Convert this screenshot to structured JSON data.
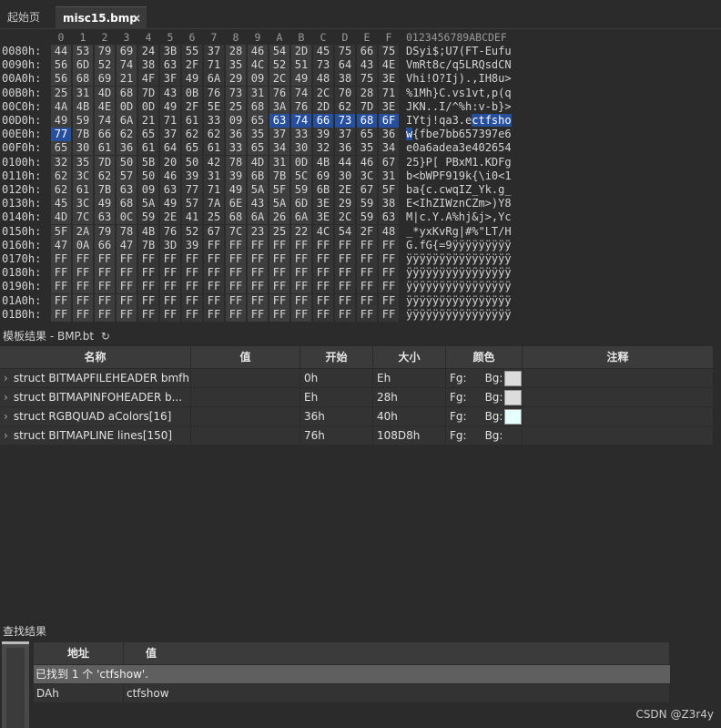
{
  "tabs": [
    {
      "label": "起始页",
      "active": false
    },
    {
      "label": "misc15.bmp",
      "active": true,
      "close": "×"
    }
  ],
  "hex": {
    "column_headers": [
      "0",
      "1",
      "2",
      "3",
      "4",
      "5",
      "6",
      "7",
      "8",
      "9",
      "A",
      "B",
      "C",
      "D",
      "E",
      "F"
    ],
    "ascii_header": "0123456789ABCDEF",
    "rows": [
      {
        "addr": "0080h:",
        "bytes": [
          "44",
          "53",
          "79",
          "69",
          "24",
          "3B",
          "55",
          "37",
          "28",
          "46",
          "54",
          "2D",
          "45",
          "75",
          "66",
          "75"
        ],
        "ascii": "DSyi$;U7(FT-Eufu"
      },
      {
        "addr": "0090h:",
        "bytes": [
          "56",
          "6D",
          "52",
          "74",
          "38",
          "63",
          "2F",
          "71",
          "35",
          "4C",
          "52",
          "51",
          "73",
          "64",
          "43",
          "4E"
        ],
        "ascii": "VmRt8c/q5LRQsdCN"
      },
      {
        "addr": "00A0h:",
        "bytes": [
          "56",
          "68",
          "69",
          "21",
          "4F",
          "3F",
          "49",
          "6A",
          "29",
          "09",
          "2C",
          "49",
          "48",
          "38",
          "75",
          "3E"
        ],
        "ascii": "Vhi!O?Ij).,IH8u>"
      },
      {
        "addr": "00B0h:",
        "bytes": [
          "25",
          "31",
          "4D",
          "68",
          "7D",
          "43",
          "0B",
          "76",
          "73",
          "31",
          "76",
          "74",
          "2C",
          "70",
          "28",
          "71"
        ],
        "ascii": "%1Mh}C.vs1vt,p(q"
      },
      {
        "addr": "00C0h:",
        "bytes": [
          "4A",
          "4B",
          "4E",
          "0D",
          "0D",
          "49",
          "2F",
          "5E",
          "25",
          "68",
          "3A",
          "76",
          "2D",
          "62",
          "7D",
          "3E"
        ],
        "ascii": "JKN..I/^%h:v-b}>"
      },
      {
        "addr": "00D0h:",
        "bytes": [
          "49",
          "59",
          "74",
          "6A",
          "21",
          "71",
          "61",
          "33",
          "09",
          "65",
          "63",
          "74",
          "66",
          "73",
          "68",
          "6F"
        ],
        "ascii": "IYtj!qa3.ectfsho",
        "sel_from": 10,
        "sel_to": 15,
        "ascii_sel_from": 10,
        "ascii_sel_to": 16
      },
      {
        "addr": "00E0h:",
        "bytes": [
          "77",
          "7B",
          "66",
          "62",
          "65",
          "37",
          "62",
          "62",
          "36",
          "35",
          "37",
          "33",
          "39",
          "37",
          "65",
          "36"
        ],
        "ascii": "w{fbe7bb657397e6",
        "sel_from": 0,
        "sel_to": 0,
        "ascii_sel_from": 0,
        "ascii_sel_to": 1
      },
      {
        "addr": "00F0h:",
        "bytes": [
          "65",
          "30",
          "61",
          "36",
          "61",
          "64",
          "65",
          "61",
          "33",
          "65",
          "34",
          "30",
          "32",
          "36",
          "35",
          "34"
        ],
        "ascii": "e0a6adea3e402654"
      },
      {
        "addr": "0100h:",
        "bytes": [
          "32",
          "35",
          "7D",
          "50",
          "5B",
          "20",
          "50",
          "42",
          "78",
          "4D",
          "31",
          "0D",
          "4B",
          "44",
          "46",
          "67"
        ],
        "ascii": "25}P[ PBxM1.KDFg"
      },
      {
        "addr": "0110h:",
        "bytes": [
          "62",
          "3C",
          "62",
          "57",
          "50",
          "46",
          "39",
          "31",
          "39",
          "6B",
          "7B",
          "5C",
          "69",
          "30",
          "3C",
          "31"
        ],
        "ascii": "b<bWPF919k{\\i0<1"
      },
      {
        "addr": "0120h:",
        "bytes": [
          "62",
          "61",
          "7B",
          "63",
          "09",
          "63",
          "77",
          "71",
          "49",
          "5A",
          "5F",
          "59",
          "6B",
          "2E",
          "67",
          "5F"
        ],
        "ascii": "ba{c.cwqIZ_Yk.g_"
      },
      {
        "addr": "0130h:",
        "bytes": [
          "45",
          "3C",
          "49",
          "68",
          "5A",
          "49",
          "57",
          "7A",
          "6E",
          "43",
          "5A",
          "6D",
          "3E",
          "29",
          "59",
          "38"
        ],
        "ascii": "E<IhZIWznCZm>)Y8"
      },
      {
        "addr": "0140h:",
        "bytes": [
          "4D",
          "7C",
          "63",
          "0C",
          "59",
          "2E",
          "41",
          "25",
          "68",
          "6A",
          "26",
          "6A",
          "3E",
          "2C",
          "59",
          "63"
        ],
        "ascii": "M|c.Y.A%hj&j>,Yc"
      },
      {
        "addr": "0150h:",
        "bytes": [
          "5F",
          "2A",
          "79",
          "78",
          "4B",
          "76",
          "52",
          "67",
          "7C",
          "23",
          "25",
          "22",
          "4C",
          "54",
          "2F",
          "48"
        ],
        "ascii": "_*yxKvRg|#%\"LT/H"
      },
      {
        "addr": "0160h:",
        "bytes": [
          "47",
          "0A",
          "66",
          "47",
          "7B",
          "3D",
          "39",
          "FF",
          "FF",
          "FF",
          "FF",
          "FF",
          "FF",
          "FF",
          "FF",
          "FF"
        ],
        "ascii": "G.fG{=9ÿÿÿÿÿÿÿÿÿ"
      },
      {
        "addr": "0170h:",
        "bytes": [
          "FF",
          "FF",
          "FF",
          "FF",
          "FF",
          "FF",
          "FF",
          "FF",
          "FF",
          "FF",
          "FF",
          "FF",
          "FF",
          "FF",
          "FF",
          "FF"
        ],
        "ascii": "ÿÿÿÿÿÿÿÿÿÿÿÿÿÿÿÿ"
      },
      {
        "addr": "0180h:",
        "bytes": [
          "FF",
          "FF",
          "FF",
          "FF",
          "FF",
          "FF",
          "FF",
          "FF",
          "FF",
          "FF",
          "FF",
          "FF",
          "FF",
          "FF",
          "FF",
          "FF"
        ],
        "ascii": "ÿÿÿÿÿÿÿÿÿÿÿÿÿÿÿÿ"
      },
      {
        "addr": "0190h:",
        "bytes": [
          "FF",
          "FF",
          "FF",
          "FF",
          "FF",
          "FF",
          "FF",
          "FF",
          "FF",
          "FF",
          "FF",
          "FF",
          "FF",
          "FF",
          "FF",
          "FF"
        ],
        "ascii": "ÿÿÿÿÿÿÿÿÿÿÿÿÿÿÿÿ"
      },
      {
        "addr": "01A0h:",
        "bytes": [
          "FF",
          "FF",
          "FF",
          "FF",
          "FF",
          "FF",
          "FF",
          "FF",
          "FF",
          "FF",
          "FF",
          "FF",
          "FF",
          "FF",
          "FF",
          "FF"
        ],
        "ascii": "ÿÿÿÿÿÿÿÿÿÿÿÿÿÿÿÿ"
      },
      {
        "addr": "01B0h:",
        "bytes": [
          "FF",
          "FF",
          "FF",
          "FF",
          "FF",
          "FF",
          "FF",
          "FF",
          "FF",
          "FF",
          "FF",
          "FF",
          "FF",
          "FF",
          "FF",
          "FF"
        ],
        "ascii": "ÿÿÿÿÿÿÿÿÿÿÿÿÿÿÿÿ"
      }
    ]
  },
  "template": {
    "title": "模板结果 - BMP.bt",
    "refresh_icon": "↻",
    "columns": [
      "名称",
      "值",
      "开始",
      "大小",
      "颜色",
      "注释"
    ],
    "rows": [
      {
        "name": "struct BITMAPFILEHEADER bmfh",
        "value": "",
        "start": "0h",
        "size": "Eh",
        "fg": "Fg:",
        "bg": "Bg:",
        "bg_color": "#dcdcdc",
        "comment": ""
      },
      {
        "name": "struct BITMAPINFOHEADER b...",
        "value": "",
        "start": "Eh",
        "size": "28h",
        "fg": "Fg:",
        "bg": "Bg:",
        "bg_color": "#dcdcdc",
        "comment": ""
      },
      {
        "name": "struct RGBQUAD aColors[16]",
        "value": "",
        "start": "36h",
        "size": "40h",
        "fg": "Fg:",
        "bg": "Bg:",
        "bg_color": "#e6ffff",
        "comment": ""
      },
      {
        "name": "struct BITMAPLINE lines[150]",
        "value": "",
        "start": "76h",
        "size": "108D8h",
        "fg": "Fg:",
        "bg": "Bg:",
        "bg_color": "",
        "comment": ""
      }
    ]
  },
  "find": {
    "title": "查找结果",
    "columns": [
      "地址",
      "值"
    ],
    "summary": "已找到 1 个 'ctfshow'.",
    "results": [
      {
        "address": "DAh",
        "value": "ctfshow"
      }
    ]
  },
  "watermark": "CSDN @Z3r4y"
}
